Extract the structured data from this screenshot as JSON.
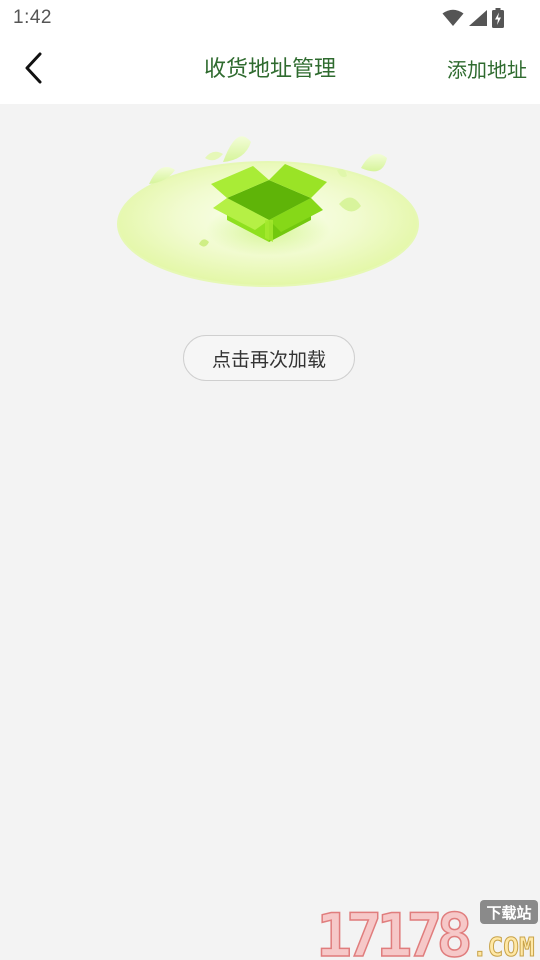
{
  "status_bar": {
    "time": "1:42",
    "icons": [
      "wifi-icon",
      "cellular-signal-icon",
      "battery-charging-icon"
    ]
  },
  "header": {
    "title": "收货地址管理",
    "back_icon": "chevron-left-icon",
    "action_label": "添加地址"
  },
  "empty_state": {
    "illustration": "open-box-icon",
    "reload_label": "点击再次加载"
  },
  "watermark": {
    "brand": "17178",
    "domain": ".COM",
    "tag": "下载站"
  },
  "colors": {
    "accent_text": "#2f6b2f",
    "background": "#f3f3f3",
    "box_green": "#7edb1a"
  }
}
